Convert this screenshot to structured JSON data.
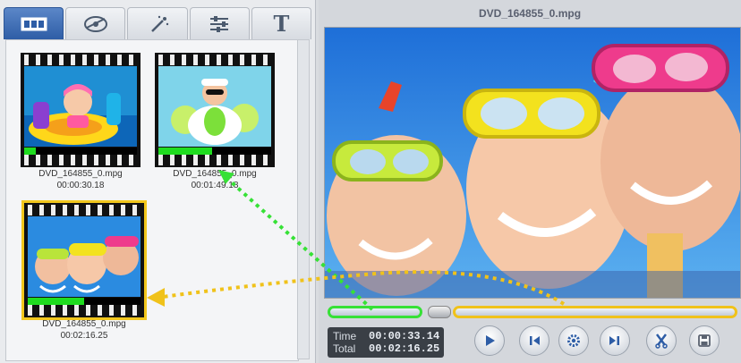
{
  "tabs": [
    {
      "id": "clips",
      "icon": "film-strip-icon",
      "active": true
    },
    {
      "id": "effects",
      "icon": "film-reel-icon",
      "active": false
    },
    {
      "id": "magic",
      "icon": "magic-wand-icon",
      "active": false
    },
    {
      "id": "adjust",
      "icon": "sliders-icon",
      "active": false
    },
    {
      "id": "text",
      "icon": "text-icon",
      "label": "T",
      "active": false
    }
  ],
  "clips": [
    {
      "name": "DVD_164855_0.mpg",
      "duration": "00:00:30.18",
      "progress": 0.1,
      "selected": false
    },
    {
      "name": "DVD_164855_0.mpg",
      "duration": "00:01:49.18",
      "progress": 0.48,
      "selected": false
    },
    {
      "name": "DVD_164855_0.mpg",
      "duration": "00:02:16.25",
      "progress": 0.5,
      "selected": true
    }
  ],
  "player": {
    "title": "DVD_164855_0.mpg",
    "time_label": "Time",
    "total_label": "Total",
    "time": "00:00:33.14",
    "total": "00:02:16.25"
  },
  "controls": [
    {
      "name": "play-button",
      "icon": "play-icon"
    },
    {
      "name": "prev-frame-button",
      "icon": "step-back-icon"
    },
    {
      "name": "settings-button",
      "icon": "gear-icon"
    },
    {
      "name": "next-frame-button",
      "icon": "step-forward-icon"
    },
    {
      "name": "cut-button",
      "icon": "scissors-icon"
    },
    {
      "name": "save-button",
      "icon": "save-icon"
    }
  ],
  "colors": {
    "accent_green": "#1fdc1f",
    "accent_yellow": "#f0c21a",
    "tab_active": "#2e5da6"
  }
}
